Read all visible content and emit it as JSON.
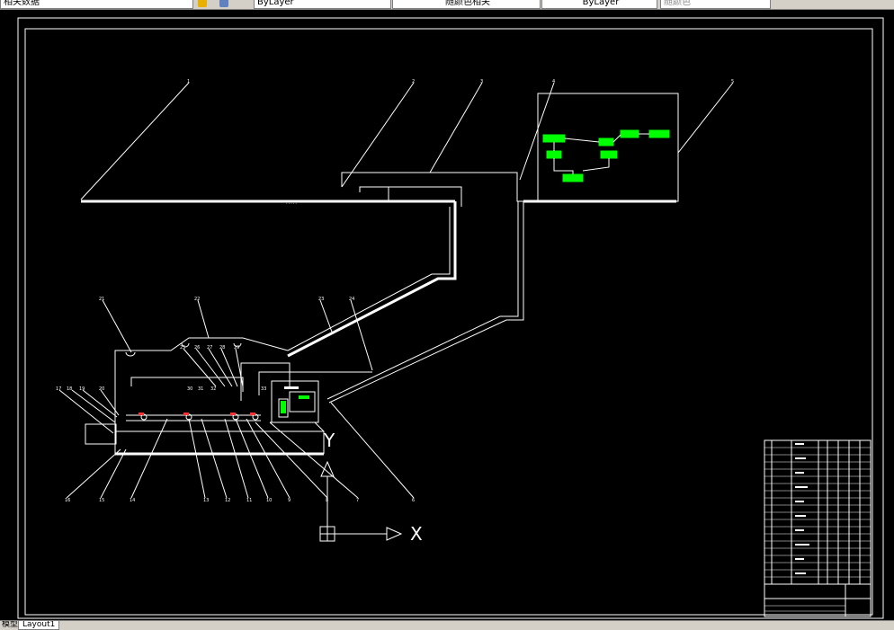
{
  "toolbar": {
    "field1": "相关数据",
    "field2": "ByLayer",
    "field3": "随颜色相关",
    "field4": "ByLayer",
    "field5": "随颜色"
  },
  "tabs": {
    "model": "模型",
    "layout": "Layout1"
  },
  "drawing": {
    "axis_x": "X",
    "axis_y": "Y",
    "callouts": [
      "1",
      "2",
      "3",
      "4",
      "5",
      "6",
      "7",
      "8",
      "9",
      "10",
      "11",
      "12",
      "13",
      "14",
      "15",
      "16",
      "17",
      "18",
      "19",
      "20",
      "21",
      "22",
      "23",
      "24",
      "25",
      "26",
      "27",
      "28",
      "29",
      "30",
      "31",
      "32",
      "33"
    ],
    "ellipsis": ".....",
    "colors": {
      "lines": "#ffffff",
      "boxes": "#00ff00",
      "background": "#000000"
    }
  }
}
